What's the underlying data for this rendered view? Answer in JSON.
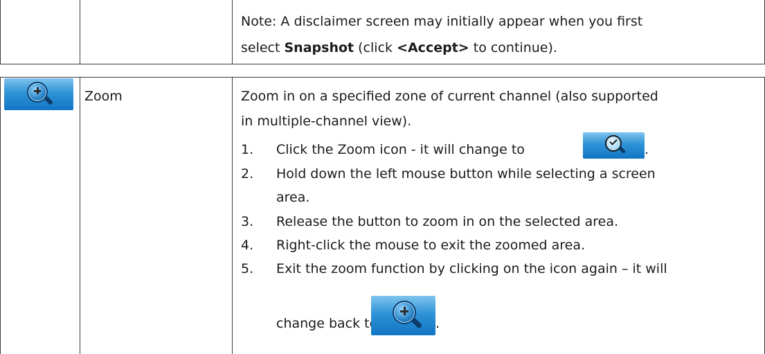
{
  "top_row": {
    "note_prefix": "Note: A disclaimer screen may initially appear when you first",
    "note_line2_pre": "select ",
    "note_bold1": "Snapshot",
    "note_line2_mid": " (click ",
    "note_bold2": "<Accept>",
    "note_line2_post": " to continue)."
  },
  "zoom_row": {
    "icon_name": "zoom-in-icon",
    "name": "Zoom",
    "description_line1": "Zoom in on a specified zone of current channel (also supported",
    "description_line2": "in multiple-channel view).",
    "steps": [
      {
        "num": "1.",
        "text": "Click the Zoom icon - it will change to",
        "icon": "zoom-active-icon",
        "suffix": "."
      },
      {
        "num": "2.",
        "line1": "Hold down the left mouse button while selecting a screen",
        "line2": "area."
      },
      {
        "num": "3.",
        "text": "Release the button to zoom in on the selected area."
      },
      {
        "num": "4.",
        "text": "Right-click the mouse to exit the zoomed area."
      },
      {
        "num": "5.",
        "line1": "Exit the zoom function by clicking on the icon again – it will",
        "line2": "change back to",
        "icon": "zoom-in-icon",
        "suffix": "."
      }
    ]
  }
}
